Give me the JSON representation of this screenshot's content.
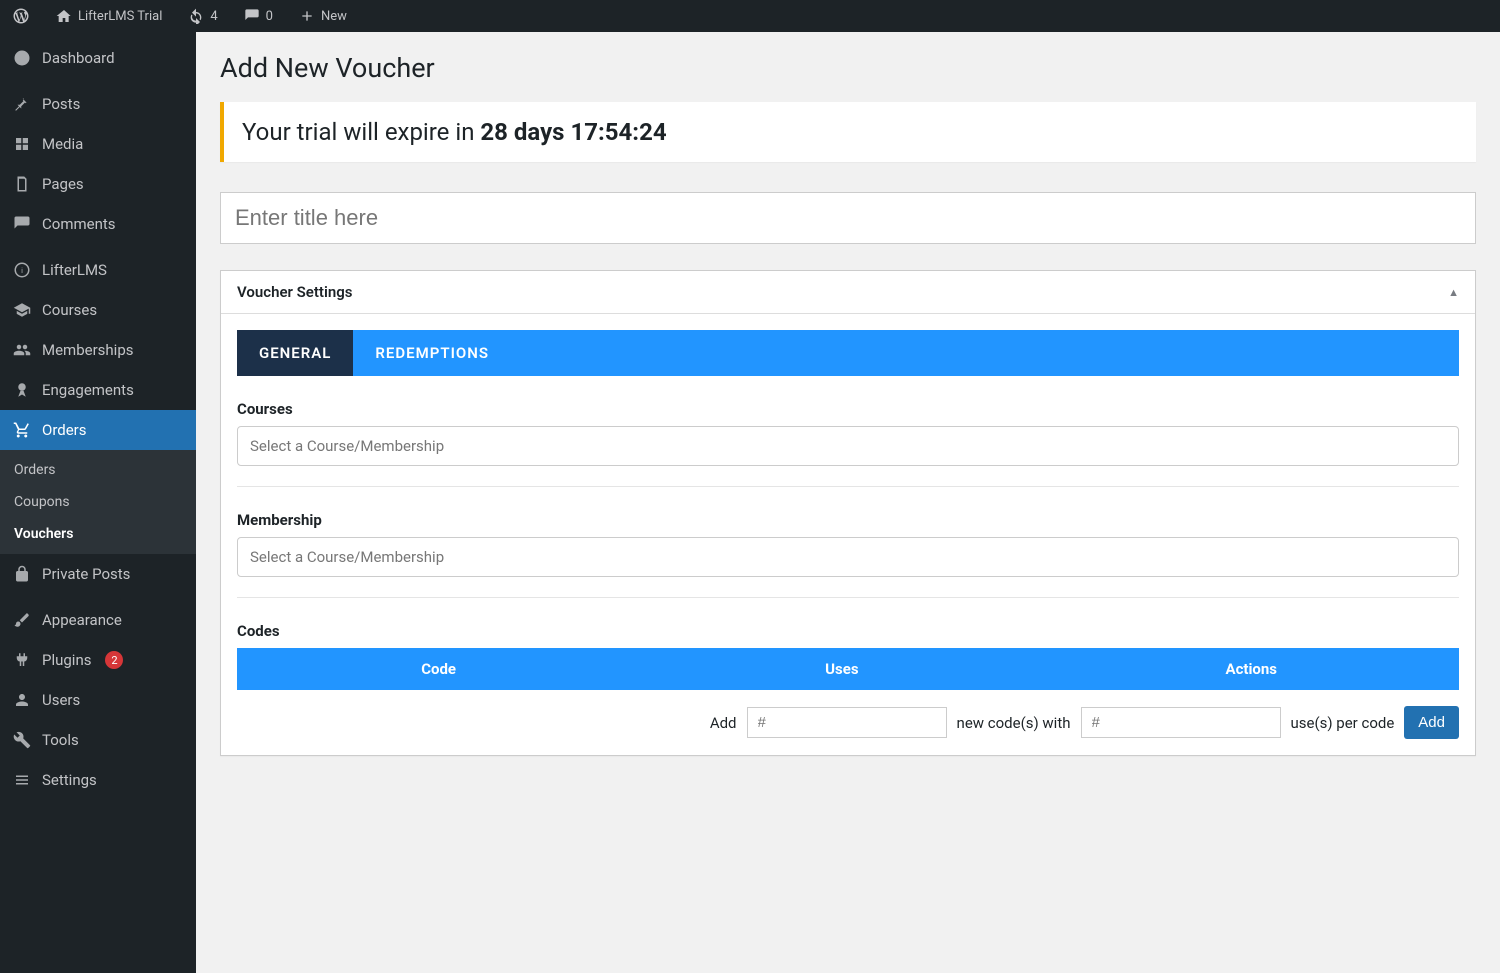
{
  "adminbar": {
    "site_name": "LifterLMS Trial",
    "updates_count": "4",
    "comments_count": "0",
    "new_label": "New"
  },
  "sidebar": {
    "dashboard": "Dashboard",
    "posts": "Posts",
    "media": "Media",
    "pages": "Pages",
    "comments": "Comments",
    "lifterlms": "LifterLMS",
    "courses": "Courses",
    "memberships": "Memberships",
    "engagements": "Engagements",
    "orders": "Orders",
    "submenu": {
      "orders": "Orders",
      "coupons": "Coupons",
      "vouchers": "Vouchers"
    },
    "private_posts": "Private Posts",
    "appearance": "Appearance",
    "plugins": "Plugins",
    "plugins_badge": "2",
    "users": "Users",
    "tools": "Tools",
    "settings": "Settings"
  },
  "page": {
    "title": "Add New Voucher",
    "trial_prefix": "Your trial will expire in ",
    "trial_bold": "28 days 17:54:24",
    "title_placeholder": "Enter title here",
    "metabox_title": "Voucher Settings",
    "tabs": {
      "general": "GENERAL",
      "redemptions": "REDEMPTIONS"
    },
    "courses_label": "Courses",
    "courses_placeholder": "Select a Course/Membership",
    "membership_label": "Membership",
    "membership_placeholder": "Select a Course/Membership",
    "codes_label": "Codes",
    "table": {
      "code": "Code",
      "uses": "Uses",
      "actions": "Actions"
    },
    "footer": {
      "add_label": "Add",
      "num_placeholder": "#",
      "new_codes_with": "new code(s) with",
      "uses_per_code": "use(s) per code",
      "add_button": "Add"
    }
  }
}
